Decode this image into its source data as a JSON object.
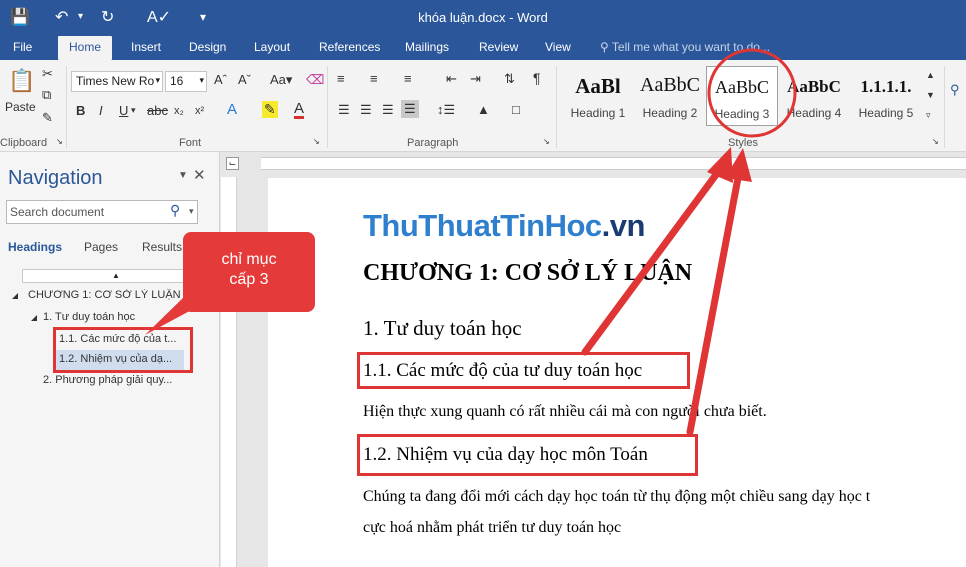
{
  "window": {
    "title": "khóa luận.docx - Word"
  },
  "tabs": {
    "file": "File",
    "home": "Home",
    "insert": "Insert",
    "design": "Design",
    "layout": "Layout",
    "references": "References",
    "mailings": "Mailings",
    "review": "Review",
    "view": "View"
  },
  "tellme": "Tell me what you want to do...",
  "ribbon": {
    "clipboard": {
      "label": "Clipboard",
      "paste": "Paste"
    },
    "font": {
      "label": "Font",
      "name": "Times New Ro",
      "size": "16"
    },
    "paragraph": {
      "label": "Paragraph"
    },
    "styles": {
      "label": "Styles",
      "items": [
        {
          "preview": "AaBl",
          "name": "Heading 1"
        },
        {
          "preview": "AaBbC",
          "name": "Heading 2"
        },
        {
          "preview": "AaBbC",
          "name": "Heading 3"
        },
        {
          "preview": "AaBbC",
          "name": "Heading 4"
        },
        {
          "preview": "1.1.1.1.",
          "name": "Heading 5"
        }
      ]
    }
  },
  "nav": {
    "title": "Navigation",
    "search_placeholder": "Search document",
    "tabs": [
      "Headings",
      "Pages",
      "Results"
    ],
    "headings": [
      {
        "text": "CHƯƠNG 1: CƠ SỞ LÝ LUẬN"
      },
      {
        "text": "1. Tư duy toán học"
      },
      {
        "text": "1.1. Các mức độ của t..."
      },
      {
        "text": "1.2. Nhiệm vụ của dạ..."
      },
      {
        "text": "2. Phương pháp giải quy..."
      }
    ]
  },
  "callout": {
    "line1": "chỉ mục",
    "line2": "cấp 3"
  },
  "document": {
    "brand_a": "ThuThuatTinHoc",
    "brand_b": ".vn",
    "chapter": "CHƯƠNG 1: CƠ SỞ LÝ LUẬN",
    "h1": "1. Tư duy toán học",
    "h3a": "1.1. Các mức độ của tư duy toán học",
    "para1": "Hiện thực xung quanh có rất nhiều cái mà con người chưa biết.",
    "h3b": "1.2. Nhiệm vụ của dạy học môn Toán",
    "para2a": "Chúng ta đang đổi mới cách dạy học toán từ thụ động một chiều sang dạy học t",
    "para2b": "cực hoá nhằm phát triển tư duy toán học"
  },
  "colors": {
    "word_blue": "#2b579a",
    "annotation_red": "#e03535"
  }
}
